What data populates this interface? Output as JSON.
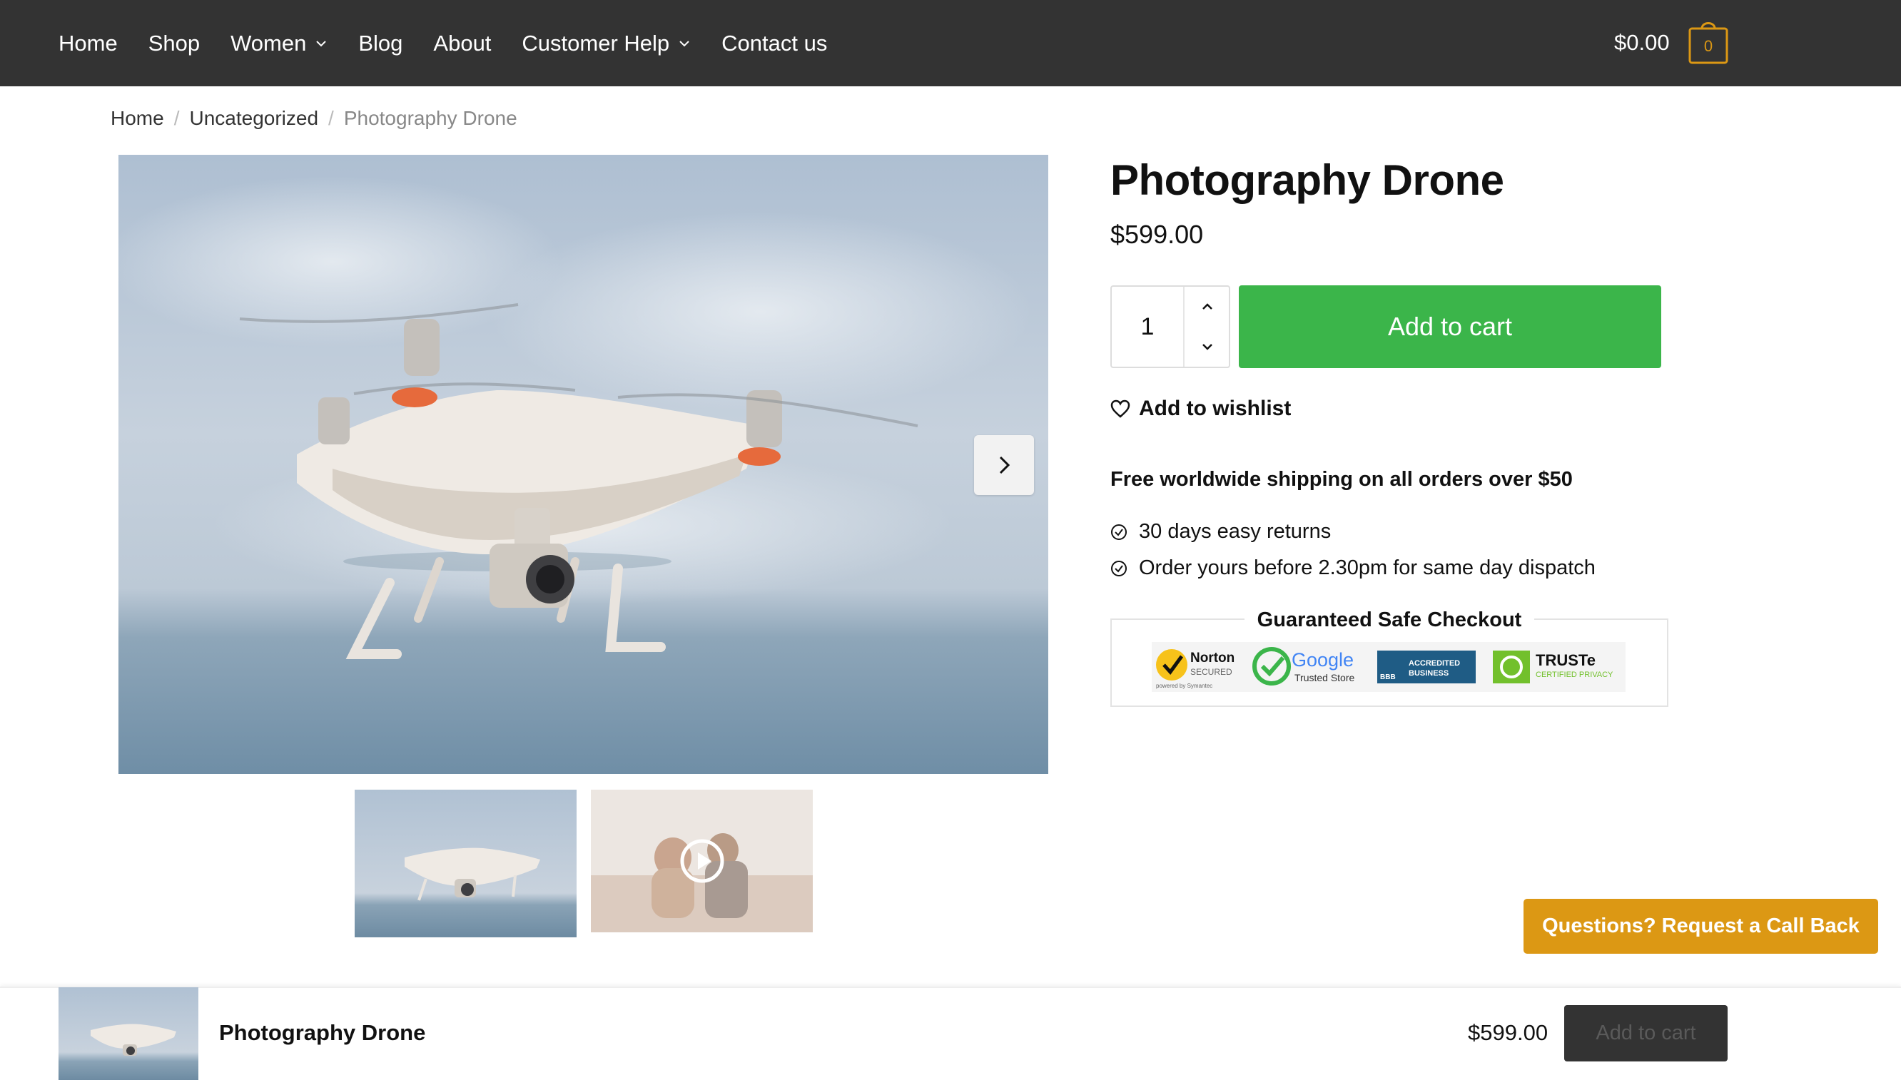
{
  "nav": {
    "items": [
      {
        "label": "Home",
        "has_dropdown": false
      },
      {
        "label": "Shop",
        "has_dropdown": false
      },
      {
        "label": "Women",
        "has_dropdown": true
      },
      {
        "label": "Blog",
        "has_dropdown": false
      },
      {
        "label": "About",
        "has_dropdown": false
      },
      {
        "label": "Customer Help",
        "has_dropdown": true
      },
      {
        "label": "Contact us",
        "has_dropdown": false
      }
    ],
    "cart_total": "$0.00",
    "cart_count": "0"
  },
  "breadcrumb": {
    "home": "Home",
    "category": "Uncategorized",
    "current": "Photography Drone",
    "separator": "/"
  },
  "product": {
    "title": "Photography Drone",
    "price": "$599.00",
    "quantity": "1",
    "add_to_cart_label": "Add to cart",
    "wishlist_label": "Add to wishlist",
    "shipping_note": "Free worldwide shipping on all orders over $50",
    "perks": [
      "30 days easy returns",
      "Order yours before 2.30pm for same day dispatch"
    ],
    "safe_checkout_title": "Guaranteed Safe Checkout",
    "badges": {
      "norton_1": "Norton",
      "norton_2": "SECURED",
      "norton_3": "powered by Symantec",
      "google_1": "Google",
      "google_2": "Trusted Store",
      "bbb_1": "ACCREDITED",
      "bbb_2": "BUSINESS",
      "bbb_3": "BBB",
      "truste_1": "TRUSTe",
      "truste_2": "CERTIFIED PRIVACY"
    }
  },
  "callback_label": "Questions? Request a Call Back",
  "sticky": {
    "title": "Photography Drone",
    "price": "$599.00",
    "button_label": "Add to cart"
  },
  "colors": {
    "topbar": "#333333",
    "add_to_cart": "#3bb54a",
    "accent": "#dc9814"
  }
}
